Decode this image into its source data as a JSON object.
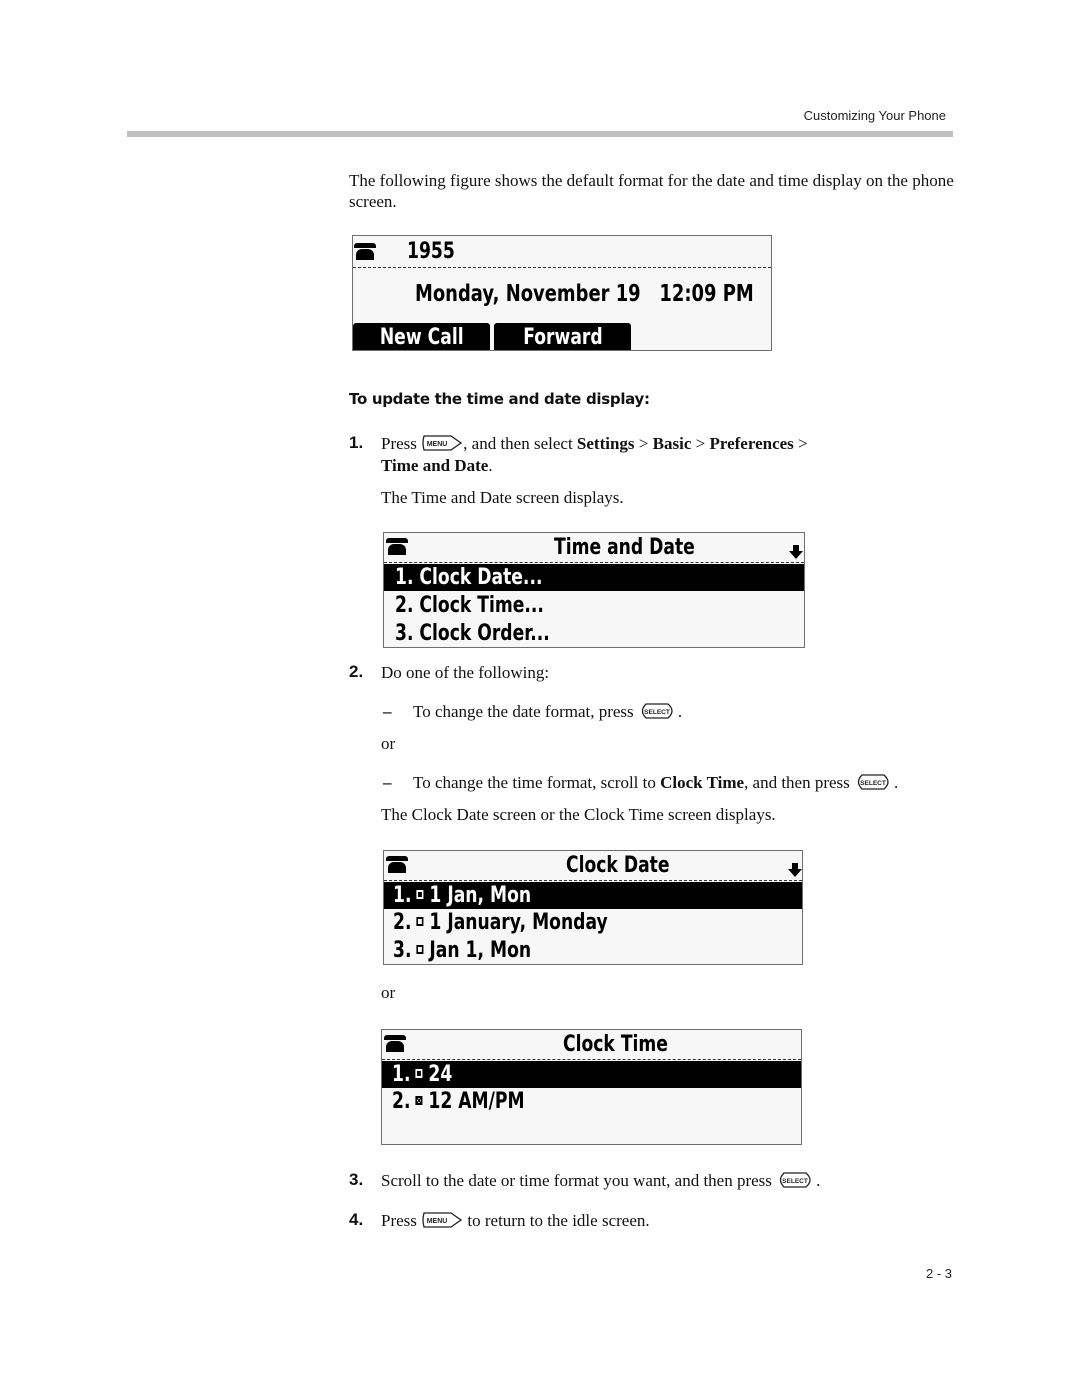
{
  "header": {
    "running_head": "Customizing Your Phone"
  },
  "intro_text": "The following figure shows the default format for the date and time display on the phone screen.",
  "idle_screen": {
    "line_number": "1955",
    "date_time": "Monday, November 19   12:09 PM",
    "softkeys": [
      "New Call",
      "Forward"
    ],
    "icons": [
      "phone-handset-icon"
    ]
  },
  "procedure": {
    "heading": "To update the time and date display:",
    "steps": [
      {
        "number": "1.",
        "text_before_key": "Press",
        "key": "MENU",
        "text_after_key": ", and then select",
        "path": [
          "Settings",
          "Basic",
          "Preferences",
          "Time and Date"
        ],
        "path_separator": ">",
        "end_punct": ".",
        "result": "The Time and Date screen displays."
      },
      {
        "number": "2.",
        "text": "Do one of the following:",
        "options": [
          {
            "bullet": "–",
            "text_before_key": "To change the date format, press",
            "key": "SELECT",
            "end_punct": "."
          },
          {
            "bullet": "–",
            "text_before_bold": "To change the time format, scroll to",
            "bold": "Clock Time",
            "text_after_bold": ", and then press",
            "key": "SELECT",
            "end_punct": "."
          }
        ],
        "or_label": "or",
        "result": "The Clock Date screen or the Clock Time screen displays."
      },
      {
        "number": "3.",
        "text_before_key": "Scroll to the date or time format you want, and then press",
        "key": "SELECT",
        "end_punct": "."
      },
      {
        "number": "4.",
        "text_before_key": "Press",
        "key": "MENU",
        "text_after_key": "to return to the idle screen."
      }
    ]
  },
  "time_date_screen": {
    "title": "Time and Date",
    "items": [
      "1. Clock Date...",
      "2. Clock Time...",
      "3. Clock Order..."
    ],
    "selected_index": 0,
    "icons": [
      "phone-handset-icon",
      "scroll-down-arrow-icon"
    ]
  },
  "clock_date_screen": {
    "title": "Clock Date",
    "items": [
      {
        "num": "1.",
        "label": "1 Jan, Mon",
        "checked": false
      },
      {
        "num": "2.",
        "label": "1 January, Monday",
        "checked": false
      },
      {
        "num": "3.",
        "label": "Jan 1, Mon",
        "checked": false
      }
    ],
    "selected_index": 0
  },
  "or_between_screens": "or",
  "clock_time_screen": {
    "title": "Clock Time",
    "items": [
      {
        "num": "1.",
        "label": "24",
        "checked": false
      },
      {
        "num": "2.",
        "label": "12 AM/PM",
        "checked": true
      }
    ],
    "selected_index": 0
  },
  "footer": {
    "page_number": "2 - 3"
  }
}
